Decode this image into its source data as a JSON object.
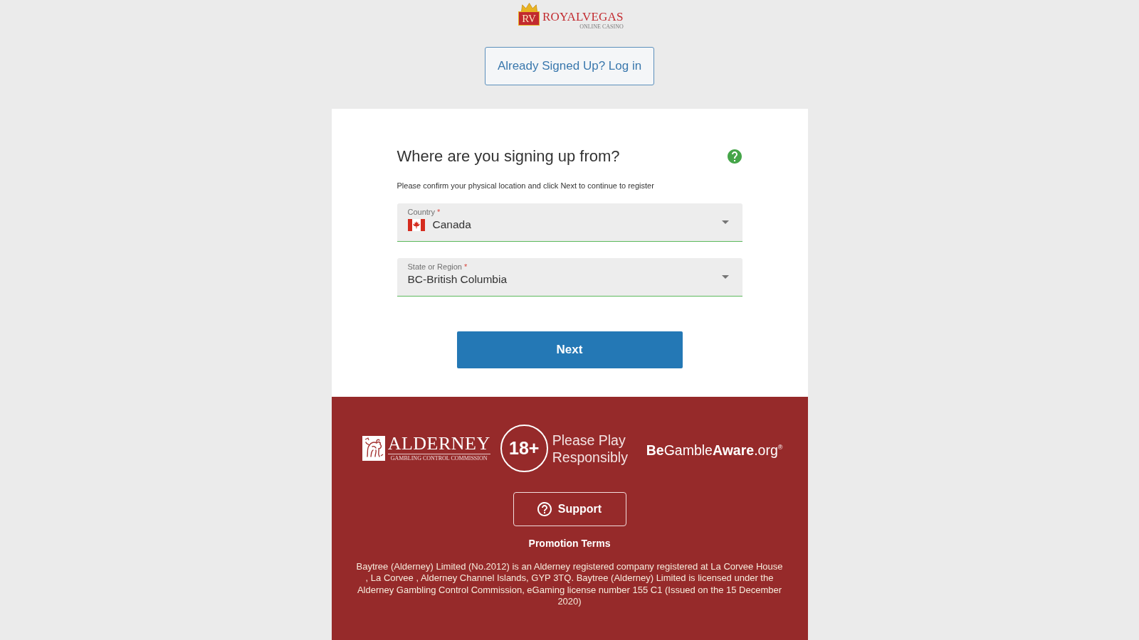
{
  "header": {
    "logo": {
      "monogram": "RV",
      "name": "ROYALVEGAS",
      "tagline": "ONLINE CASINO"
    },
    "login_button": "Already Signed Up? Log in"
  },
  "form": {
    "title": "Where are you signing up from?",
    "instruction": "Please confirm your physical location and click Next to continue to register",
    "fields": [
      {
        "kind": "country",
        "label": "Country",
        "required_mark": "*",
        "value": "Canada",
        "valid": true
      },
      {
        "kind": "region",
        "label": "State or Region",
        "required_mark": "*",
        "value": "BC-British Columbia",
        "valid": true
      }
    ],
    "next_button": "Next"
  },
  "footer": {
    "regulator": {
      "name": "ALDERNEY",
      "subtitle": "GAMBLING CONTROL COMMISSION"
    },
    "age_limit": "18+",
    "responsible_message": "Please Play Responsibly",
    "gamble_aware": "**Be**Gamble**Aware**.org$^{®}$",
    "support_button": "Support",
    "terms_link": "Promotion Terms",
    "legal_text": "Baytree (Alderney) Limited (No.2012) is an Alderney registered company registered at La Corvee House , La Corvee , Alderney Channel Islands, GYP 3TQ. Baytree (Alderney) Limited is licensed under the Alderney Gambling Control Commission, eGaming license number 155 C1 (Issued on the 15 December 2020)"
  }
}
